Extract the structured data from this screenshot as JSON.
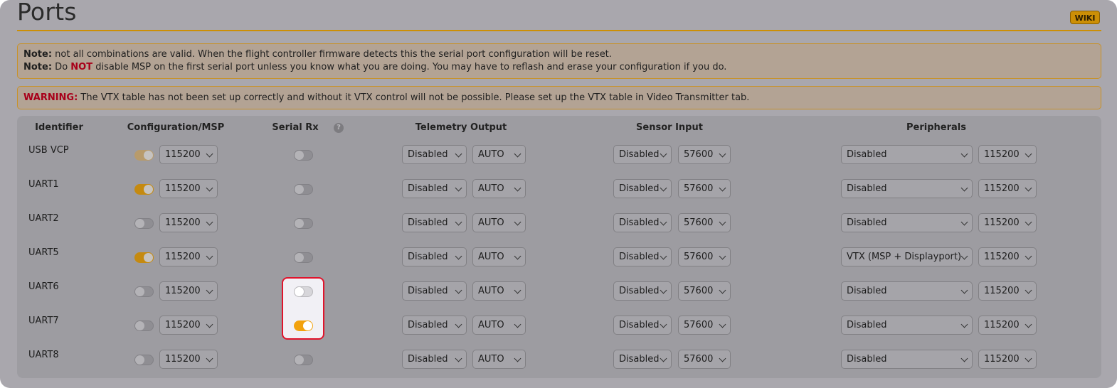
{
  "page_title": "Ports",
  "wiki_label": "WIKI",
  "notes": {
    "line1_prefix": "Note:",
    "line1_text": " not all combinations are valid. When the flight controller firmware detects this the serial port configuration will be reset.",
    "line2_prefix": "Note:",
    "line2_pre": " Do ",
    "line2_emph": "NOT",
    "line2_post": " disable MSP on the first serial port unless you know what you are doing. You may have to reflash and erase your configuration if you do."
  },
  "warning": {
    "prefix": "WARNING:",
    "text": " The VTX table has not been set up correctly and without it VTX control will not be possible. Please set up the VTX table in Video Transmitter tab."
  },
  "columns": {
    "identifier": "Identifier",
    "config_msp": "Configuration/MSP",
    "serial_rx": "Serial Rx",
    "telemetry": "Telemetry Output",
    "sensor": "Sensor Input",
    "peripherals": "Peripherals",
    "help_glyph": "?"
  },
  "colors": {
    "accent": "#cc8f06",
    "toggle_on": "#c58a10",
    "highlight_border": "#e0142c",
    "warning_red": "#a8001a"
  },
  "rows": [
    {
      "id": "USB VCP",
      "msp_on": true,
      "msp_baud": "115200",
      "serial_rx": false,
      "telemetry": "Disabled",
      "telemetry_baud": "AUTO",
      "sensor": "Disabled",
      "sensor_baud": "57600",
      "peripheral": "Disabled",
      "peripheral_baud": "115200"
    },
    {
      "id": "UART1",
      "msp_on": true,
      "msp_baud": "115200",
      "serial_rx": false,
      "telemetry": "Disabled",
      "telemetry_baud": "AUTO",
      "sensor": "Disabled",
      "sensor_baud": "57600",
      "peripheral": "Disabled",
      "peripheral_baud": "115200"
    },
    {
      "id": "UART2",
      "msp_on": false,
      "msp_baud": "115200",
      "serial_rx": false,
      "telemetry": "Disabled",
      "telemetry_baud": "AUTO",
      "sensor": "Disabled",
      "sensor_baud": "57600",
      "peripheral": "Disabled",
      "peripheral_baud": "115200"
    },
    {
      "id": "UART5",
      "msp_on": true,
      "msp_baud": "115200",
      "serial_rx": false,
      "telemetry": "Disabled",
      "telemetry_baud": "AUTO",
      "sensor": "Disabled",
      "sensor_baud": "57600",
      "peripheral": "VTX (MSP + Displayport)",
      "peripheral_baud": "115200"
    },
    {
      "id": "UART6",
      "msp_on": false,
      "msp_baud": "115200",
      "serial_rx": false,
      "telemetry": "Disabled",
      "telemetry_baud": "AUTO",
      "sensor": "Disabled",
      "sensor_baud": "57600",
      "peripheral": "Disabled",
      "peripheral_baud": "115200"
    },
    {
      "id": "UART7",
      "msp_on": false,
      "msp_baud": "115200",
      "serial_rx": true,
      "telemetry": "Disabled",
      "telemetry_baud": "AUTO",
      "sensor": "Disabled",
      "sensor_baud": "57600",
      "peripheral": "Disabled",
      "peripheral_baud": "115200"
    },
    {
      "id": "UART8",
      "msp_on": false,
      "msp_baud": "115200",
      "serial_rx": false,
      "telemetry": "Disabled",
      "telemetry_baud": "AUTO",
      "sensor": "Disabled",
      "sensor_baud": "57600",
      "peripheral": "Disabled",
      "peripheral_baud": "115200"
    }
  ]
}
